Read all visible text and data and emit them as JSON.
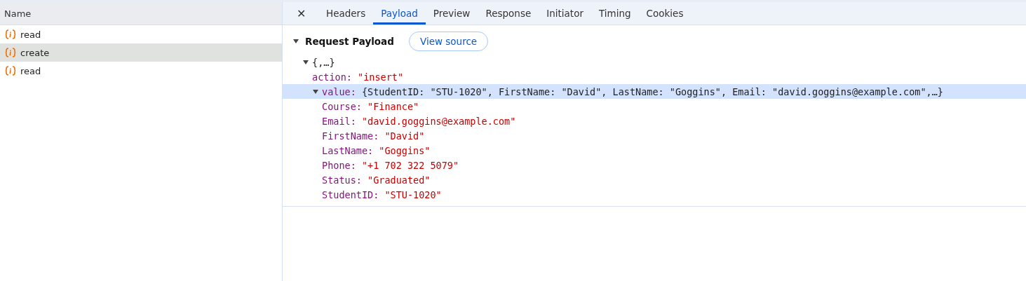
{
  "requests": {
    "column": "Name",
    "rows": [
      {
        "name": "read",
        "selected": false
      },
      {
        "name": "create",
        "selected": true
      },
      {
        "name": "read",
        "selected": false
      }
    ]
  },
  "details": {
    "close": "✕",
    "tabs": [
      {
        "label": "Headers",
        "selected": false
      },
      {
        "label": "Payload",
        "selected": true
      },
      {
        "label": "Preview",
        "selected": false
      },
      {
        "label": "Response",
        "selected": false
      },
      {
        "label": "Initiator",
        "selected": false
      },
      {
        "label": "Timing",
        "selected": false
      },
      {
        "label": "Cookies",
        "selected": false
      }
    ],
    "section": {
      "title": "Request Payload",
      "expanded": true,
      "button": "View source"
    },
    "tree": {
      "summary": "{,…}",
      "expanded": true,
      "selected": false,
      "children": [
        {
          "key": "action:",
          "value": "\"insert\""
        },
        {
          "key": "value:",
          "summary": "{StudentID: \"STU-1020\", FirstName: \"David\", LastName: \"Goggins\", Email: \"david.goggins@example.com\",…}",
          "expanded": true,
          "selected": true,
          "children": [
            {
              "key": "Course:",
              "value": "\"Finance\""
            },
            {
              "key": "Email:",
              "value": "\"david.goggins@example.com\""
            },
            {
              "key": "FirstName:",
              "value": "\"David\""
            },
            {
              "key": "LastName:",
              "value": "\"Goggins\""
            },
            {
              "key": "Phone:",
              "value": "\"+1 702 322 5079\""
            },
            {
              "key": "Status:",
              "value": "\"Graduated\""
            },
            {
              "key": "StudentID:",
              "value": "\"STU-1020\""
            }
          ]
        }
      ]
    }
  }
}
